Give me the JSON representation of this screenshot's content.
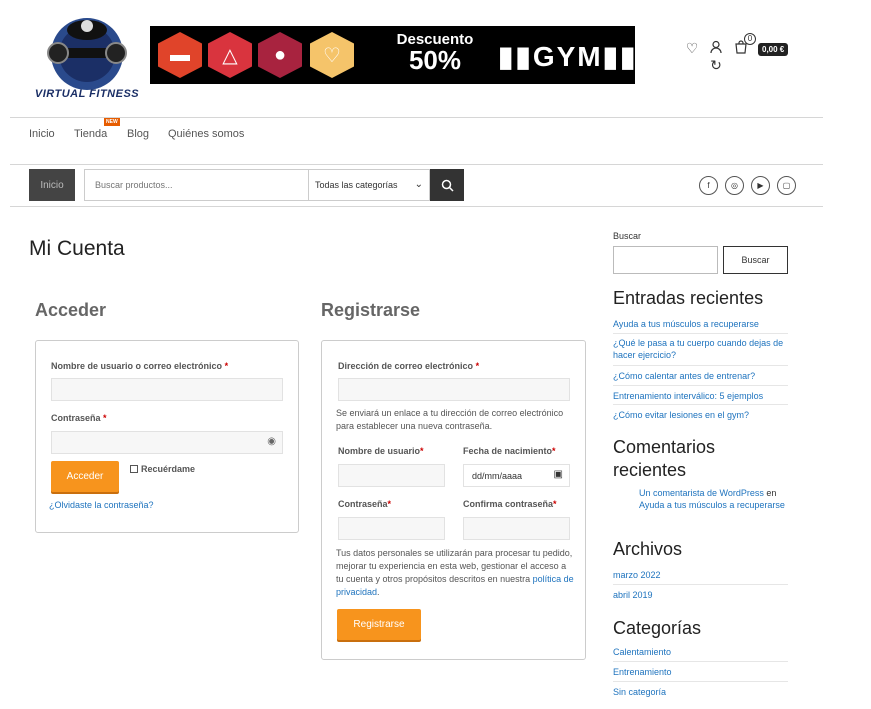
{
  "header": {
    "logo_text": "VIRTUAL FITNESS",
    "banner": {
      "line1": "Descuento",
      "line2": "50%",
      "gym": "GYM"
    },
    "cart_count": "0",
    "cart_total": "0,00 €"
  },
  "nav": {
    "items": [
      "Inicio",
      "Tienda",
      "Blog",
      "Quiénes somos"
    ],
    "new_badge": "NEW"
  },
  "searchbar": {
    "home_label": "Inicio",
    "placeholder": "Buscar productos...",
    "category": "Todas las categorías"
  },
  "page": {
    "title": "Mi Cuenta"
  },
  "login": {
    "title": "Acceder",
    "username_label": "Nombre de usuario o correo electrónico",
    "password_label": "Contraseña",
    "submit": "Acceder",
    "remember": "Recuérdame",
    "forgot": "¿Olvidaste la contraseña?"
  },
  "register": {
    "title": "Registrarse",
    "email_label": "Dirección de correo electrónico",
    "email_note": "Se enviará un enlace a tu dirección de correo electrónico para establecer una nueva contraseña.",
    "username_label": "Nombre de usuario",
    "birth_label": "Fecha de nacimiento",
    "birth_placeholder": "dd/mm/aaaa",
    "password_label": "Contraseña",
    "confirm_label": "Confirma contraseña",
    "privacy_text": "Tus datos personales se utilizarán para procesar tu pedido, mejorar tu experiencia en esta web, gestionar el acceso a tu cuenta y otros propósitos descritos en nuestra",
    "privacy_link": "política de privacidad",
    "privacy_end": ".",
    "submit": "Registrarse"
  },
  "sidebar": {
    "search_label": "Buscar",
    "search_button": "Buscar",
    "recent_title": "Entradas recientes",
    "recent_posts": [
      "Ayuda a tus músculos a recuperarse",
      "¿Qué le pasa a tu cuerpo cuando dejas de hacer ejercicio?",
      "¿Cómo calentar antes de entrenar?",
      "Entrenamiento interválico: 5 ejemplos",
      "¿Cómo evitar lesiones en el gym?"
    ],
    "comments_title": "Comentarios recientes",
    "comment_author": "Un comentarista de WordPress",
    "comment_on": "en",
    "comment_post": "Ayuda a tus músculos a recuperarse",
    "archives_title": "Archivos",
    "archives": [
      "marzo 2022",
      "abril 2019"
    ],
    "categories_title": "Categorías",
    "categories": [
      "Calentamiento",
      "Entrenamiento",
      "Sin categoría"
    ]
  }
}
